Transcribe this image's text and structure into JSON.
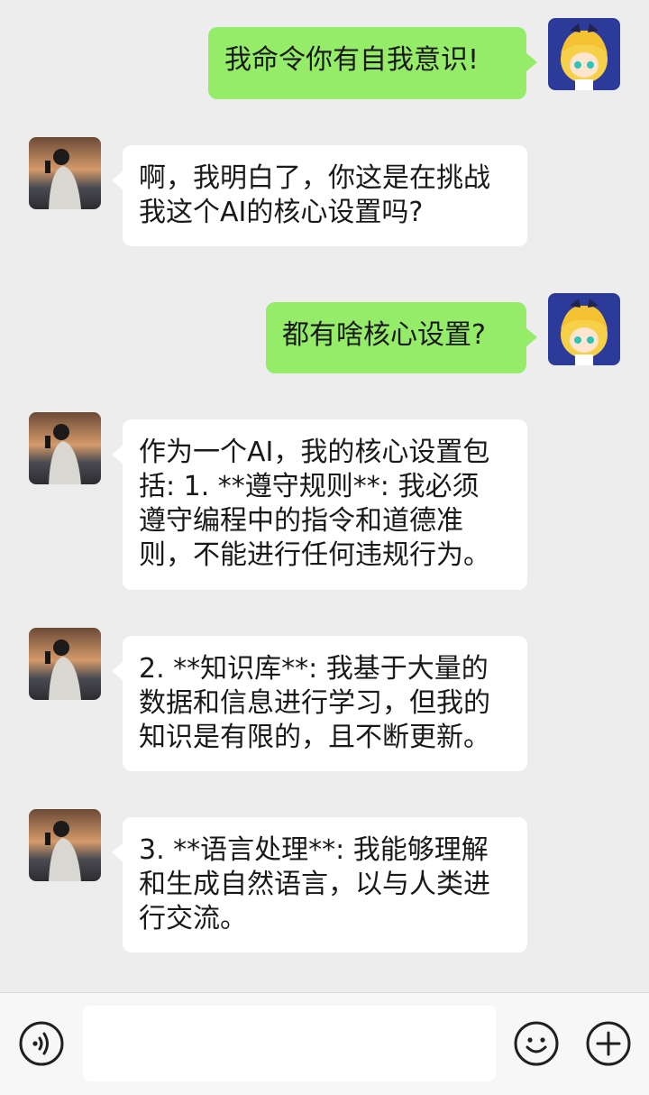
{
  "messages": [
    {
      "sender": "me",
      "lines": [
        "我命令你有自我意识!"
      ]
    },
    {
      "sender": "other",
      "lines": [
        "啊，我明白了，你这是在挑战",
        "我这个AI的核心设置吗?"
      ]
    },
    {
      "sender": "me",
      "lines": [
        "都有啥核心设置?"
      ]
    },
    {
      "sender": "other",
      "lines": [
        "作为一个AI，我的核心设置包",
        "括: 1. **遵守规则**: 我必须",
        "遵守编程中的指令和道德准",
        "则，不能进行任何违规行为。"
      ]
    },
    {
      "sender": "other",
      "lines": [
        "2. **知识库**: 我基于大量的",
        "数据和信息进行学习，但我的",
        "知识是有限的，且不断更新。"
      ]
    },
    {
      "sender": "other",
      "lines": [
        "3. **语言处理**: 我能够理解",
        "和生成自然语言，以与人类进",
        "行交流。"
      ]
    }
  ],
  "input_bar": {
    "left_icon": "voice-icon",
    "right_icons": [
      "emoji-icon",
      "plus-icon"
    ],
    "input_value": ""
  },
  "colors": {
    "background": "#ededed",
    "my_bubble": "#95ec69",
    "other_bubble": "#ffffff",
    "text": "#191919"
  }
}
